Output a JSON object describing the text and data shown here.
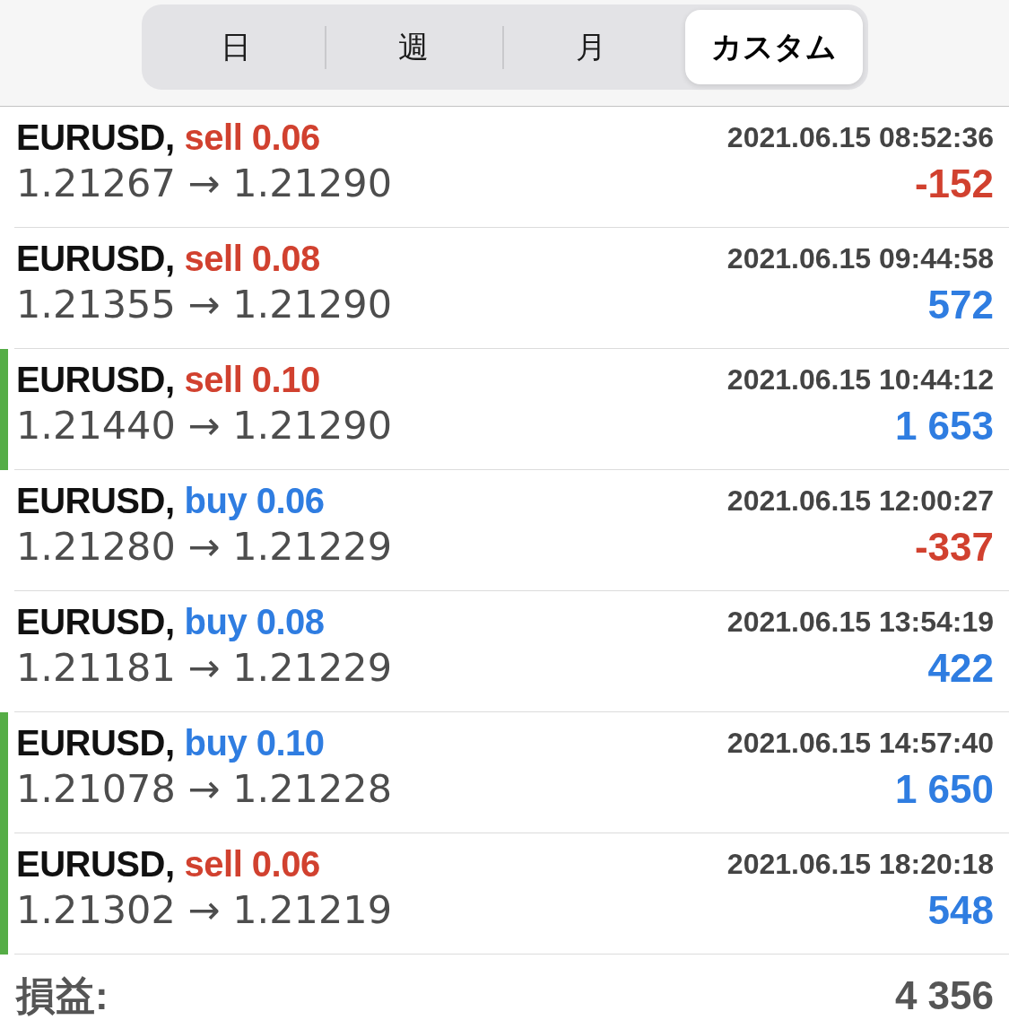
{
  "tabs": [
    {
      "label": "日",
      "selected": false
    },
    {
      "label": "週",
      "selected": false
    },
    {
      "label": "月",
      "selected": false
    },
    {
      "label": "カスタム",
      "selected": true
    }
  ],
  "trades": [
    {
      "symbol": "EURUSD,",
      "order": {
        "text": "sell 0.06",
        "color": "#d1412f"
      },
      "time": "2021.06.15 08:52:36",
      "prices": "1.21267 → 1.21290",
      "profit": {
        "text": "-152",
        "color": "#d1412f"
      },
      "marked": false
    },
    {
      "symbol": "EURUSD,",
      "order": {
        "text": "sell 0.08",
        "color": "#d1412f"
      },
      "time": "2021.06.15 09:44:58",
      "prices": "1.21355 → 1.21290",
      "profit": {
        "text": "572",
        "color": "#2f7de1"
      },
      "marked": false
    },
    {
      "symbol": "EURUSD,",
      "order": {
        "text": "sell 0.10",
        "color": "#d1412f"
      },
      "time": "2021.06.15 10:44:12",
      "prices": "1.21440 → 1.21290",
      "profit": {
        "text": "1 653",
        "color": "#2f7de1"
      },
      "marked": true
    },
    {
      "symbol": "EURUSD,",
      "order": {
        "text": "buy 0.06",
        "color": "#2f7de1"
      },
      "time": "2021.06.15 12:00:27",
      "prices": "1.21280 → 1.21229",
      "profit": {
        "text": "-337",
        "color": "#d1412f"
      },
      "marked": false
    },
    {
      "symbol": "EURUSD,",
      "order": {
        "text": "buy 0.08",
        "color": "#2f7de1"
      },
      "time": "2021.06.15 13:54:19",
      "prices": "1.21181 → 1.21229",
      "profit": {
        "text": "422",
        "color": "#2f7de1"
      },
      "marked": false
    },
    {
      "symbol": "EURUSD,",
      "order": {
        "text": "buy 0.10",
        "color": "#2f7de1"
      },
      "time": "2021.06.15 14:57:40",
      "prices": "1.21078 → 1.21228",
      "profit": {
        "text": "1 650",
        "color": "#2f7de1"
      },
      "marked": true
    },
    {
      "symbol": "EURUSD,",
      "order": {
        "text": "sell 0.06",
        "color": "#d1412f"
      },
      "time": "2021.06.15 18:20:18",
      "prices": "1.21302 → 1.21219",
      "profit": {
        "text": "548",
        "color": "#2f7de1"
      },
      "marked": true
    }
  ],
  "total": {
    "label": "損益:",
    "value": "4 356"
  }
}
